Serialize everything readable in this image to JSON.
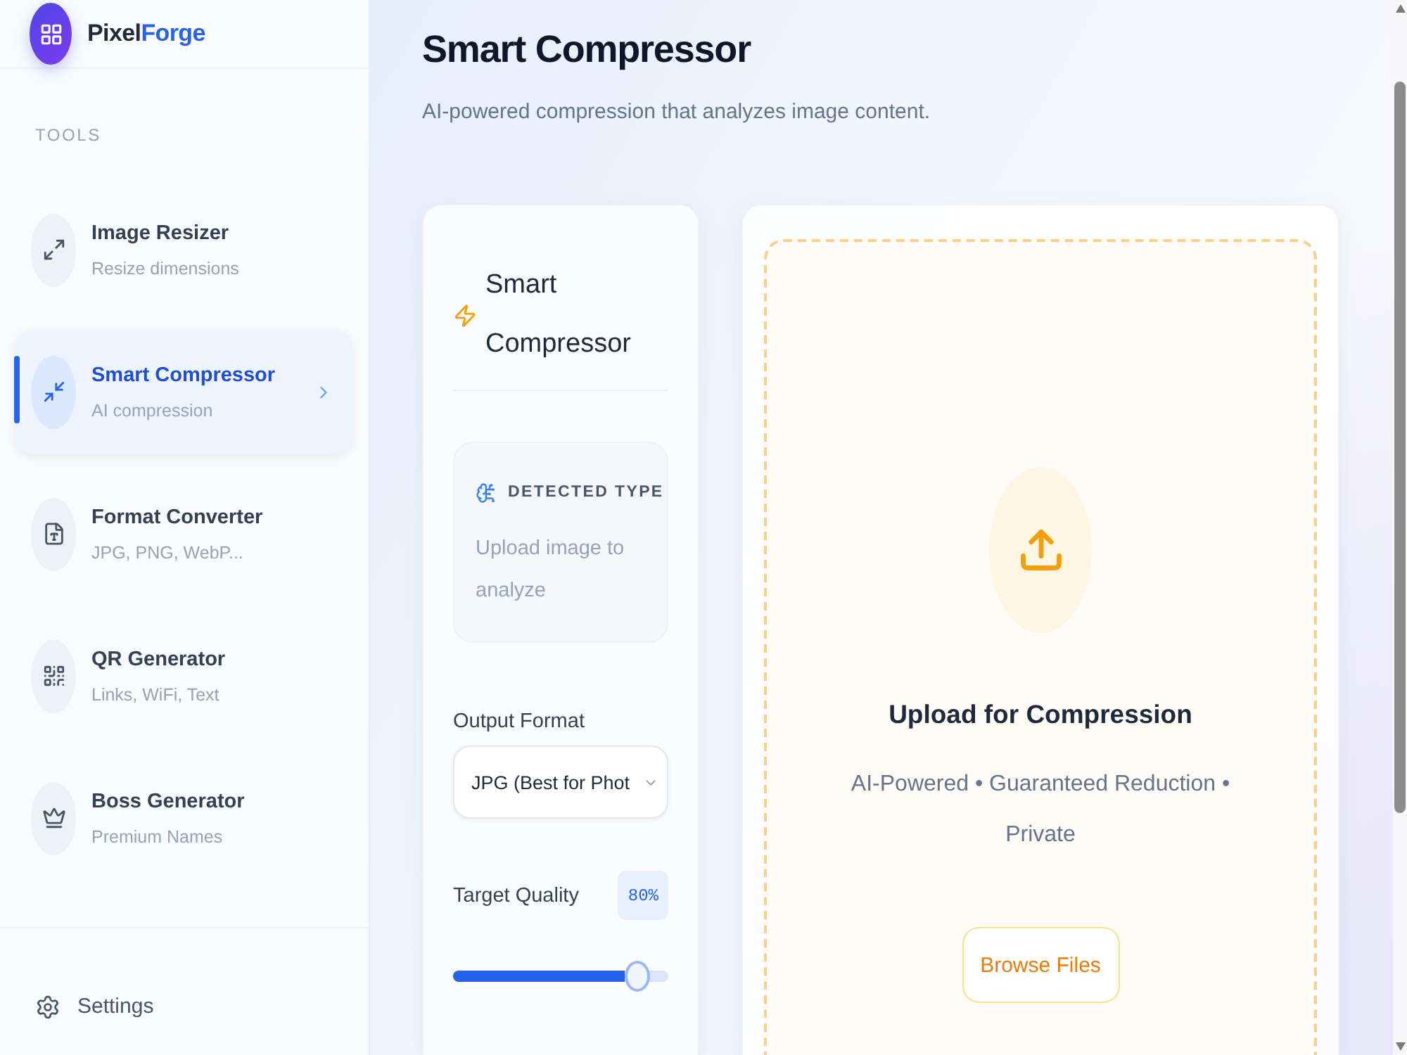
{
  "sidebar": {
    "brand": {
      "name": "Pixel",
      "accent": "Forge"
    },
    "section_label": "TOOLS",
    "items": [
      {
        "kind": "resizer",
        "title": "Image Resizer",
        "subtitle": "Resize dimensions",
        "selected": false
      },
      {
        "kind": "compressor",
        "title": "Smart Compressor",
        "subtitle": "AI compression",
        "selected": true
      },
      {
        "kind": "converter",
        "title": "Format Converter",
        "subtitle": "JPG, PNG, WebP...",
        "selected": false
      },
      {
        "kind": "qr",
        "title": "QR Generator",
        "subtitle": "Links, WiFi, Text",
        "selected": false
      },
      {
        "kind": "names",
        "title": "Boss Generator",
        "subtitle": "Premium Names",
        "selected": false
      }
    ],
    "settings": {
      "label": "Settings"
    }
  },
  "page": {
    "title": "Smart Compressor",
    "subtitle": "AI-powered compression that analyzes image content."
  },
  "options_panel": {
    "title": "Smart Compressor",
    "detected_type": {
      "label": "DETECTED TYPE",
      "value": "Upload image to analyze"
    },
    "output_format": {
      "label": "Output Format",
      "value": "JPG (Best for Phot"
    },
    "target_quality": {
      "label": "Target Quality",
      "reading": "80%",
      "level": 0.8
    }
  },
  "upload_panel": {
    "title": "Upload for Compression",
    "subtitle": "AI-Powered • Guaranteed Reduction • Private",
    "button": "Browse Files"
  }
}
